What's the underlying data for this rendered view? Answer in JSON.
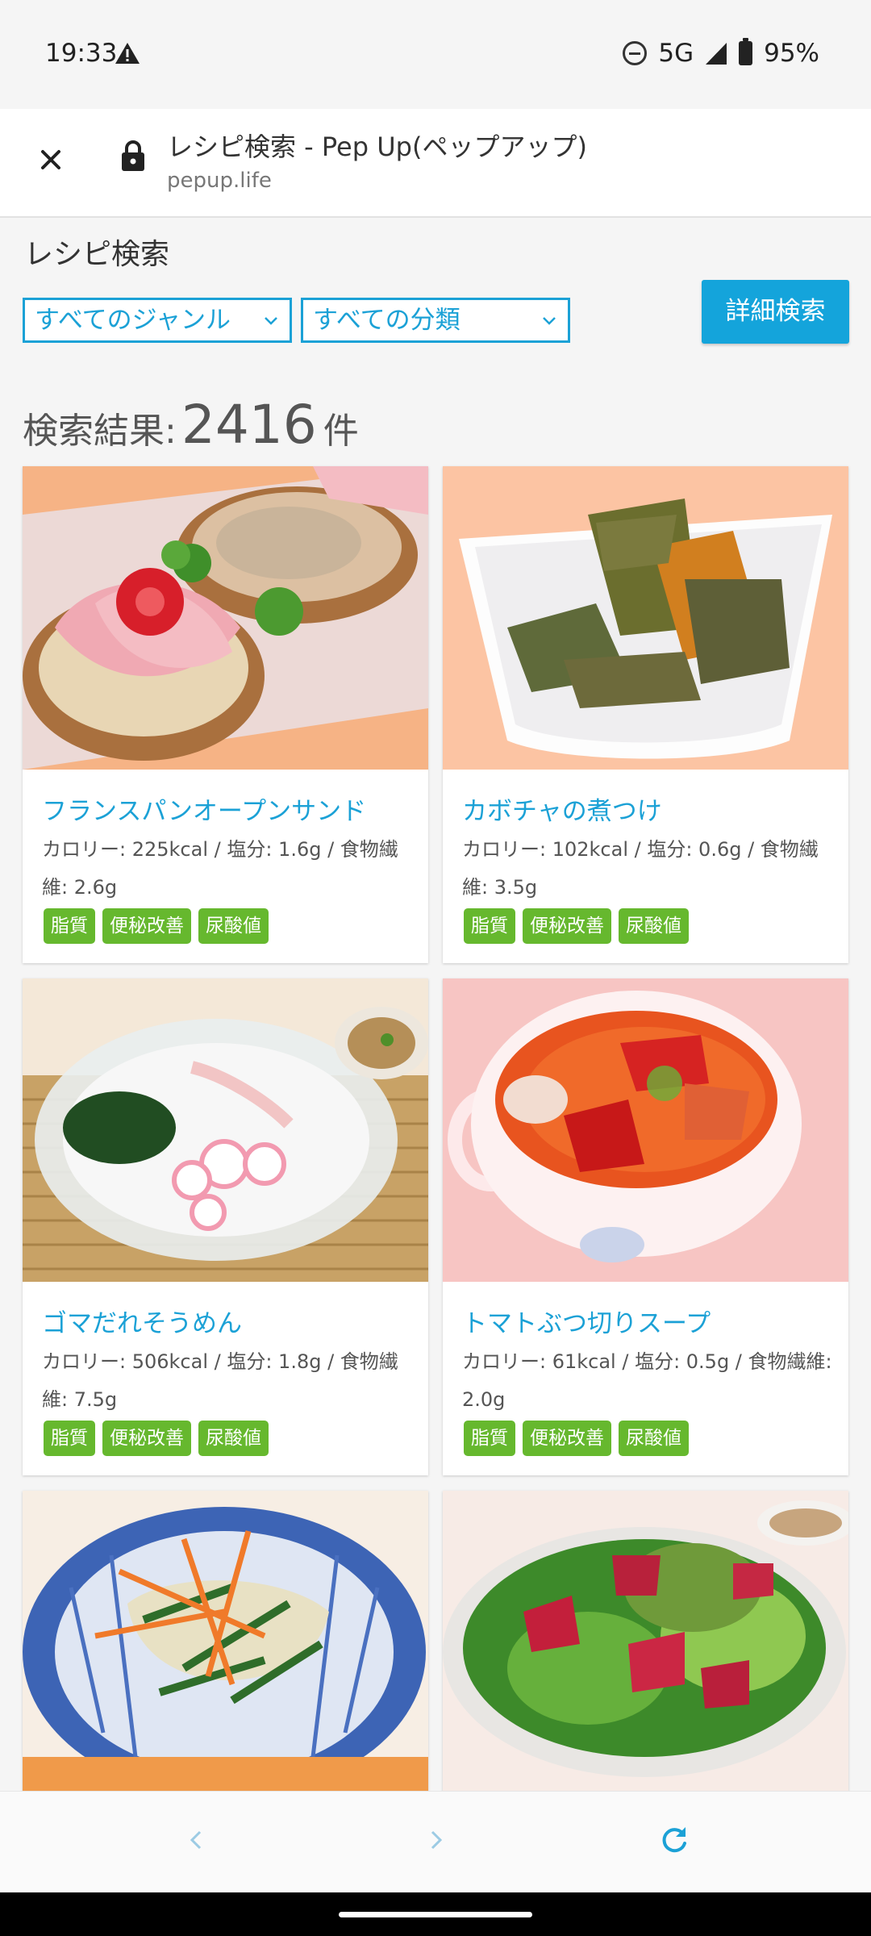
{
  "status": {
    "time": "19:33",
    "network": "5G",
    "battery": "95%"
  },
  "tab": {
    "title": "レシピ検索 - Pep Up(ペップアップ)",
    "url": "pepup.life"
  },
  "page": {
    "heading": "レシピ検索",
    "genre_select": "すべてのジャンル",
    "class_select": "すべての分類",
    "detail_button": "詳細検索",
    "results_label": "検索結果:",
    "results_count": "2416",
    "results_unit": "件"
  },
  "recipes": [
    {
      "name": "フランスパンオープンサンド",
      "nutrition": "カロリー: 225kcal / 塩分: 1.6g / 食物繊維: 2.6g",
      "tags": [
        "脂質",
        "便秘改善",
        "尿酸値"
      ]
    },
    {
      "name": "カボチャの煮つけ",
      "nutrition": "カロリー: 102kcal / 塩分: 0.6g / 食物繊維: 3.5g",
      "tags": [
        "脂質",
        "便秘改善",
        "尿酸値"
      ]
    },
    {
      "name": "ゴマだれそうめん",
      "nutrition": "カロリー: 506kcal / 塩分: 1.8g / 食物繊維: 7.5g",
      "tags": [
        "脂質",
        "便秘改善",
        "尿酸値"
      ]
    },
    {
      "name": "トマトぶつ切りスープ",
      "nutrition": "カロリー: 61kcal / 塩分: 0.5g / 食物繊維: 2.0g",
      "tags": [
        "脂質",
        "便秘改善",
        "尿酸値"
      ]
    }
  ],
  "colors": {
    "accent": "#1ba1d6",
    "button": "#14a4db",
    "tag": "#66b82e"
  },
  "icons": {
    "close": "close-icon",
    "lock": "lock-icon",
    "back": "chevron-left-icon",
    "forward": "chevron-right-icon",
    "reload": "reload-icon"
  }
}
